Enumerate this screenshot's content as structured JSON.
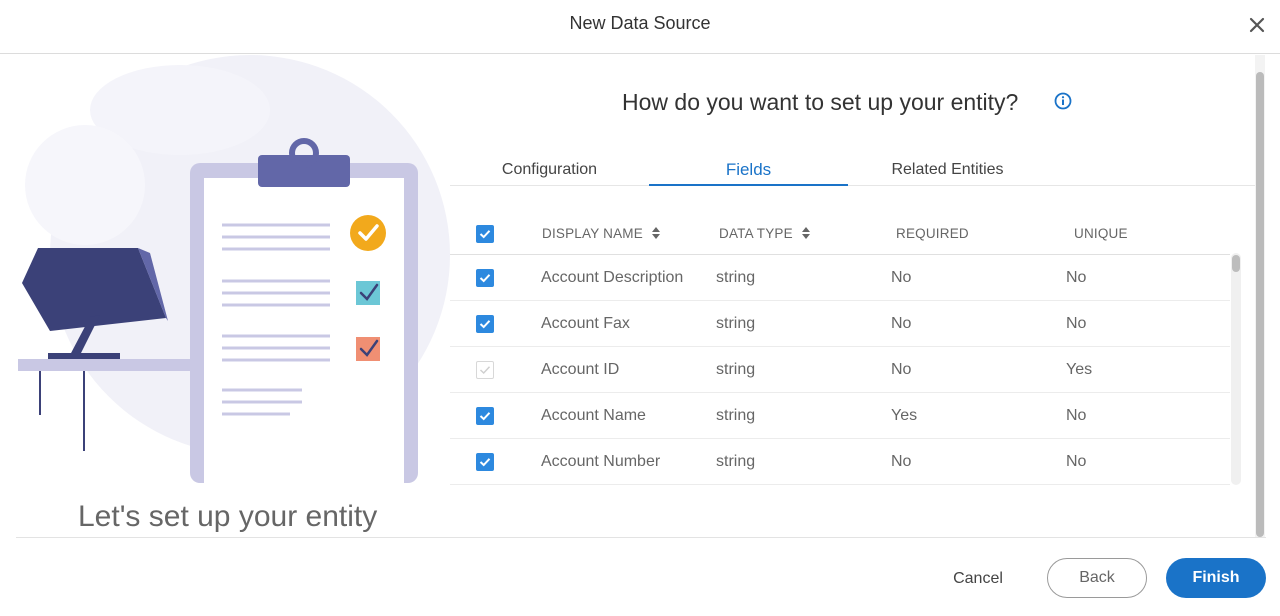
{
  "dialog": {
    "title": "New Data Source",
    "close_icon": "close-icon"
  },
  "left_panel": {
    "tagline": "Let's set up your entity",
    "illustration": "clipboard-checklist-with-monitor"
  },
  "main": {
    "question": "How do you want to set up your entity?",
    "info_icon": "info-icon",
    "tabs": [
      {
        "label": "Configuration",
        "active": false
      },
      {
        "label": "Fields",
        "active": true
      },
      {
        "label": "Related Entities",
        "active": false
      }
    ],
    "table": {
      "select_all_checked": true,
      "columns": [
        "DISPLAY NAME",
        "DATA TYPE",
        "REQUIRED",
        "UNIQUE"
      ],
      "rows": [
        {
          "checked": true,
          "disabled": false,
          "display_name": "Account Description",
          "data_type": "string",
          "required": "No",
          "unique": "No"
        },
        {
          "checked": true,
          "disabled": false,
          "display_name": "Account Fax",
          "data_type": "string",
          "required": "No",
          "unique": "No"
        },
        {
          "checked": true,
          "disabled": true,
          "display_name": "Account ID",
          "data_type": "string",
          "required": "No",
          "unique": "Yes"
        },
        {
          "checked": true,
          "disabled": false,
          "display_name": "Account Name",
          "data_type": "string",
          "required": "Yes",
          "unique": "No"
        },
        {
          "checked": true,
          "disabled": false,
          "display_name": "Account Number",
          "data_type": "string",
          "required": "No",
          "unique": "No"
        }
      ]
    }
  },
  "footer": {
    "cancel_label": "Cancel",
    "back_label": "Back",
    "finish_label": "Finish"
  },
  "colors": {
    "accent": "#1a73c8",
    "checkbox": "#2d89df",
    "illustration_navy": "#3b4178",
    "illustration_lavender": "#c9c8e4",
    "check_orange": "#f2a91c",
    "check_teal": "#6cc7d6",
    "check_coral": "#f08f73"
  }
}
